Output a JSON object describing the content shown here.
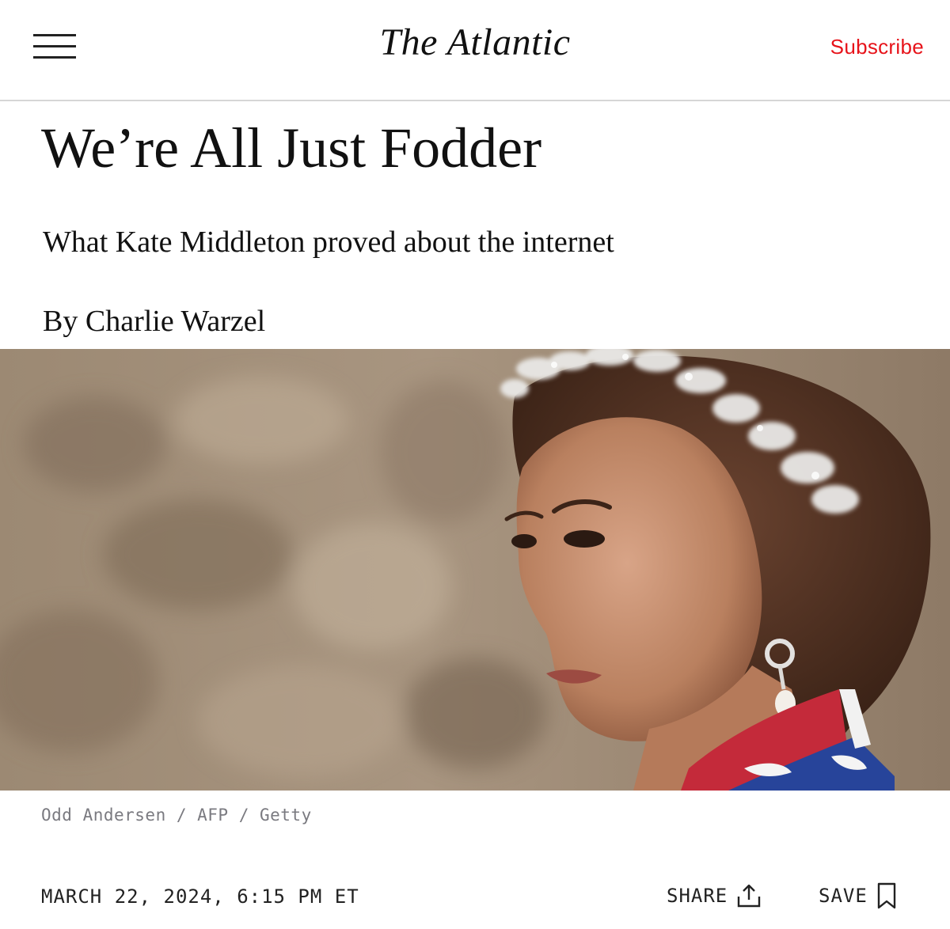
{
  "header": {
    "menu_icon": "hamburger-menu-icon",
    "logo": "The Atlantic",
    "subscribe_label": "Subscribe",
    "accent_color": "#e7131a"
  },
  "article": {
    "headline": "We’re All Just Fodder",
    "dek": "What Kate Middleton proved about the internet",
    "byline_prefix": "By",
    "author": "Charlie Warzel",
    "image_credit": "Odd Andersen / AFP / Getty",
    "date": "MARCH 22, 2024, 6:15 PM ET"
  },
  "actions": {
    "share_label": "SHARE",
    "share_icon": "share-upload-icon",
    "save_label": "SAVE",
    "save_icon": "bookmark-icon"
  }
}
